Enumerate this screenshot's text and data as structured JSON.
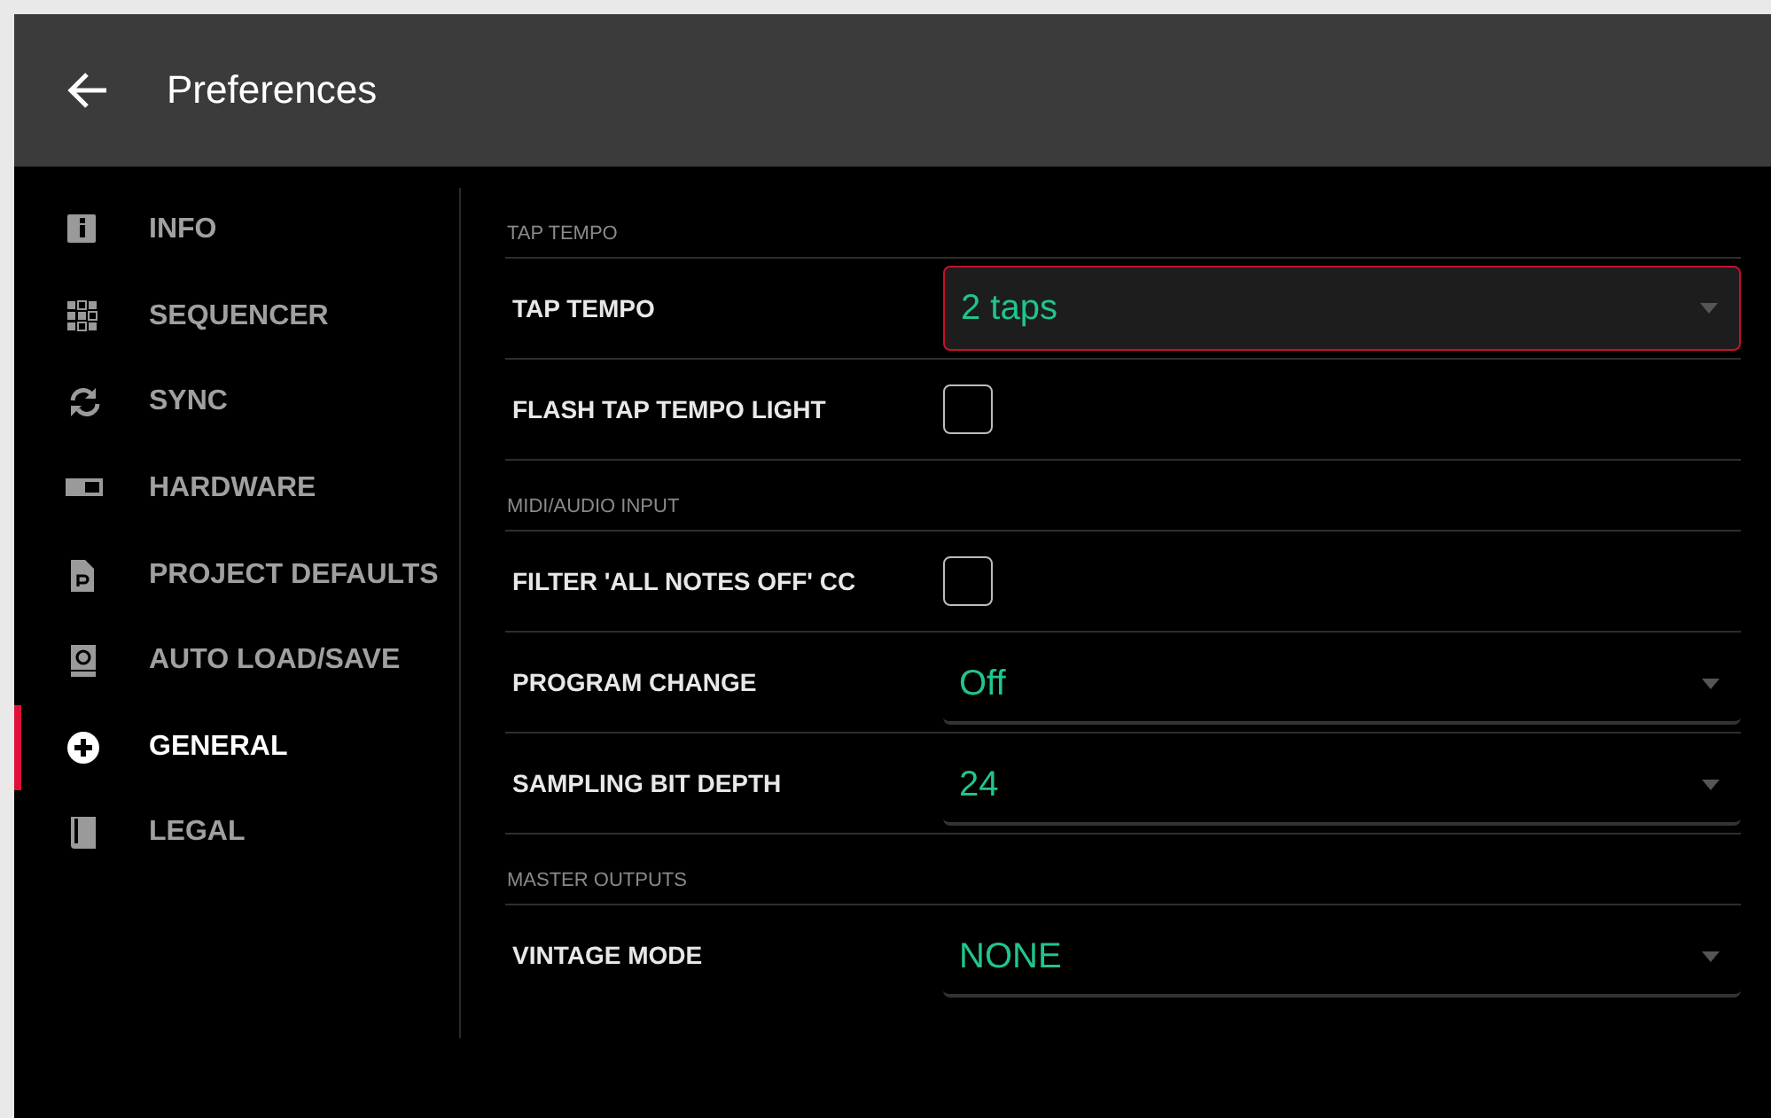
{
  "header": {
    "title": "Preferences"
  },
  "sidebar": {
    "items": [
      {
        "label": "INFO",
        "selected": false
      },
      {
        "label": "SEQUENCER",
        "selected": false
      },
      {
        "label": "SYNC",
        "selected": false
      },
      {
        "label": "HARDWARE",
        "selected": false
      },
      {
        "label": "PROJECT DEFAULTS",
        "selected": false
      },
      {
        "label": "AUTO LOAD/SAVE",
        "selected": false
      },
      {
        "label": "GENERAL",
        "selected": true
      },
      {
        "label": "LEGAL",
        "selected": false
      }
    ]
  },
  "sections": [
    {
      "title": "TAP TEMPO",
      "rows": [
        {
          "kind": "dropdown",
          "label": "TAP TEMPO",
          "value": "2 taps",
          "focused": true
        },
        {
          "kind": "checkbox",
          "label": "FLASH TAP TEMPO LIGHT",
          "checked": false
        }
      ]
    },
    {
      "title": "MIDI/AUDIO INPUT",
      "rows": [
        {
          "kind": "checkbox",
          "label": "FILTER 'ALL NOTES OFF' CC",
          "checked": false
        },
        {
          "kind": "dropdown",
          "label": "PROGRAM CHANGE",
          "value": "Off",
          "focused": false
        },
        {
          "kind": "dropdown",
          "label": "SAMPLING BIT DEPTH",
          "value": "24",
          "focused": false
        }
      ]
    },
    {
      "title": "MASTER OUTPUTS",
      "rows": [
        {
          "kind": "dropdown",
          "label": "VINTAGE MODE",
          "value": "NONE",
          "focused": false
        }
      ]
    }
  ]
}
